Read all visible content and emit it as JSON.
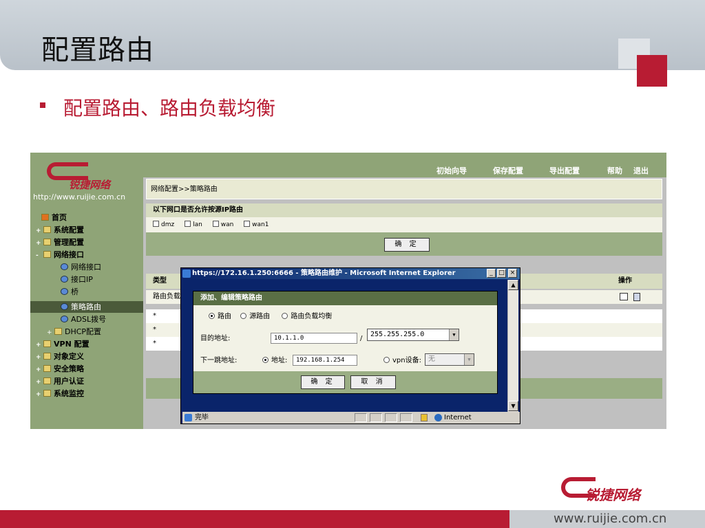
{
  "slide": {
    "title": "配置路由",
    "bullet": "配置路由、路由负载均衡",
    "footer_url": "www.ruijie.com.cn",
    "logo_text": "锐捷网络"
  },
  "app": {
    "logo_text": "锐捷网络",
    "logo_url": "http://www.ruijie.com.cn",
    "top_nav": [
      "初始向导",
      "保存配置",
      "导出配置",
      "帮助",
      "退出"
    ],
    "sidebar": [
      {
        "label": "首页",
        "icon": "home-icon",
        "expander": ""
      },
      {
        "label": "系统配置",
        "icon": "folder-icon",
        "expander": "+"
      },
      {
        "label": "管理配置",
        "icon": "folder-icon",
        "expander": "+"
      },
      {
        "label": "网络接口",
        "icon": "folder-icon",
        "expander": "-"
      },
      {
        "label": "网络接口",
        "icon": "page-icon",
        "expander": ""
      },
      {
        "label": "接口IP",
        "icon": "page-icon",
        "expander": ""
      },
      {
        "label": "桥",
        "icon": "page-icon",
        "expander": ""
      },
      {
        "label": "策略路由",
        "icon": "page-icon",
        "expander": ""
      },
      {
        "label": "ADSL拨号",
        "icon": "page-icon",
        "expander": ""
      },
      {
        "label": "DHCP配置",
        "icon": "folder-icon",
        "expander": "+"
      },
      {
        "label": "VPN 配置",
        "icon": "folder-icon",
        "expander": "+"
      },
      {
        "label": "对象定义",
        "icon": "folder-icon",
        "expander": "+"
      },
      {
        "label": "安全策略",
        "icon": "folder-icon",
        "expander": "+"
      },
      {
        "label": "用户认证",
        "icon": "folder-icon",
        "expander": "+"
      },
      {
        "label": "系统监控",
        "icon": "folder-icon",
        "expander": "+"
      }
    ],
    "breadcrumb": "网络配置>>策略路由",
    "source_ip_section": {
      "heading": "以下网口是否允许按源IP路由",
      "checkboxes": [
        "dmz",
        "lan",
        "wan",
        "wan1"
      ],
      "confirm": "确 定"
    },
    "table": {
      "col_type": "类型",
      "col_action": "操作",
      "rows": [
        "路由负载",
        "*",
        "*",
        "*"
      ]
    }
  },
  "ie_window": {
    "title": "https://172.16.1.250:6666 - 策略路由维护 - Microsoft Internet Explorer",
    "status": "完毕",
    "zone": "Internet",
    "dialog": {
      "heading": "添加、编辑策略路由",
      "route_types": [
        "路由",
        "源路由",
        "路由负载均衡"
      ],
      "dest_label": "目的地址:",
      "dest_ip": "10.1.1.0",
      "slash": "/",
      "mask": "255.255.255.0",
      "nexthop_label": "下一跳地址:",
      "addr_option": "地址:",
      "nexthop_ip": "192.168.1.254",
      "vpn_option": "vpn设备:",
      "vpn_value": "无",
      "confirm": "确 定",
      "cancel": "取 消"
    }
  }
}
